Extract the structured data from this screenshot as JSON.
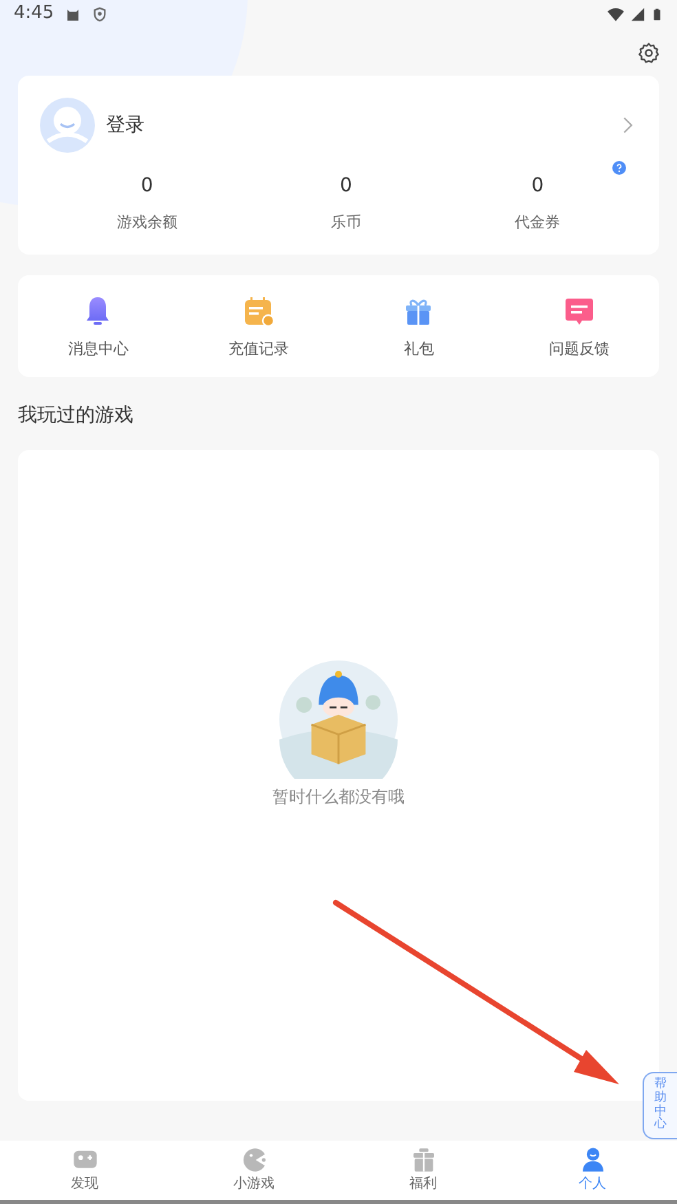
{
  "status_bar": {
    "time": "4:45"
  },
  "account": {
    "login_label": "登录",
    "stats": [
      {
        "value": "0",
        "label": "游戏余额"
      },
      {
        "value": "0",
        "label": "乐币"
      },
      {
        "value": "0",
        "label": "代金券"
      }
    ]
  },
  "shortcuts": [
    {
      "kind": "bell",
      "label": "消息中心"
    },
    {
      "kind": "calendar",
      "label": "充值记录"
    },
    {
      "kind": "gift",
      "label": "礼包"
    },
    {
      "kind": "feedback",
      "label": "问题反馈"
    }
  ],
  "played_games": {
    "title": "我玩过的游戏",
    "empty_text": "暂时什么都没有哦"
  },
  "help_tab": {
    "label": "帮助中心"
  },
  "bottom_nav": [
    {
      "kind": "gamepad",
      "label": "发现",
      "selected": false
    },
    {
      "kind": "pacman",
      "label": "小游戏",
      "selected": false
    },
    {
      "kind": "gift",
      "label": "福利",
      "selected": false
    },
    {
      "kind": "person",
      "label": "个人",
      "selected": true
    }
  ]
}
